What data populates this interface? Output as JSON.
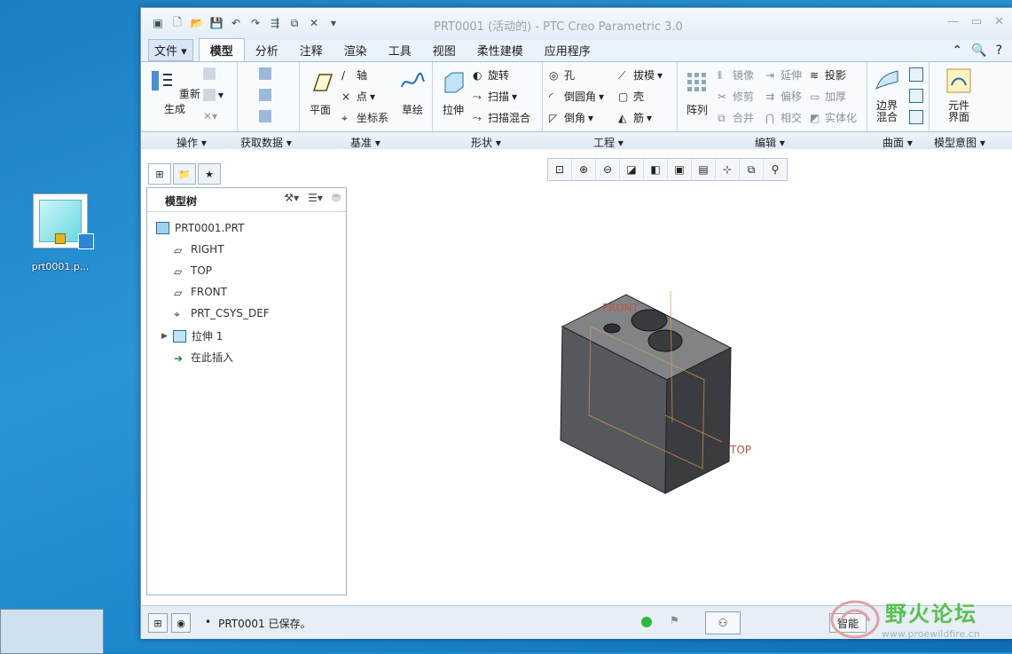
{
  "desktop": {
    "icon_label": "prt0001.p..."
  },
  "window": {
    "title": "PRT0001 (活动的) - PTC Creo Parametric 3.0",
    "controls": [
      "—",
      "▭",
      "✕"
    ]
  },
  "tabs": {
    "file": "文件",
    "items": [
      "模型",
      "分析",
      "注释",
      "渲染",
      "工具",
      "视图",
      "柔性建模",
      "应用程序"
    ],
    "active": "模型"
  },
  "ribbon": {
    "operations": {
      "regenerate": "重新生成"
    },
    "datum": {
      "plane": "平面",
      "axis": "轴",
      "point": "点",
      "csys": "坐标系",
      "sketch": "草绘"
    },
    "shapes": {
      "extrude": "拉伸",
      "revolve": "旋转",
      "sweep": "扫描",
      "swept_blend": "扫描混合"
    },
    "engineering": {
      "hole": "孔",
      "round": "倒圆角",
      "chamfer": "倒角",
      "draft": "拔模",
      "shell": "壳",
      "rib": "筋"
    },
    "editing": {
      "pattern": "阵列",
      "mirror": "镜像",
      "trim": "修剪",
      "merge": "合并",
      "extend": "延伸",
      "offset": "偏移",
      "intersect": "相交",
      "project": "投影",
      "thicken": "加厚",
      "solidify": "实体化"
    },
    "surfaces": {
      "boundary_blend": "边界混合"
    },
    "model_intent": {
      "component_interface": "元件界面"
    },
    "group_labels": [
      "操作",
      "获取数据",
      "基准",
      "形状",
      "工程",
      "编辑",
      "曲面",
      "模型意图"
    ]
  },
  "model_tree": {
    "title": "模型树",
    "items": [
      {
        "label": "PRT0001.PRT",
        "icon": "part-icon"
      },
      {
        "label": "RIGHT",
        "icon": "datum-plane-icon"
      },
      {
        "label": "TOP",
        "icon": "datum-plane-icon"
      },
      {
        "label": "FRONT",
        "icon": "datum-plane-icon"
      },
      {
        "label": "PRT_CSYS_DEF",
        "icon": "csys-icon"
      },
      {
        "label": "拉伸 1",
        "icon": "extrude-icon"
      },
      {
        "label": "在此插入",
        "icon": "insert-arrow-icon"
      }
    ]
  },
  "viewport": {
    "plane_label_front": "FRONT",
    "plane_label_top": "TOP"
  },
  "status": {
    "message": "PRT0001 已保存。",
    "smart": "智能"
  },
  "watermark": {
    "name": "野火论坛",
    "url": "www.proewildfire.cn"
  }
}
